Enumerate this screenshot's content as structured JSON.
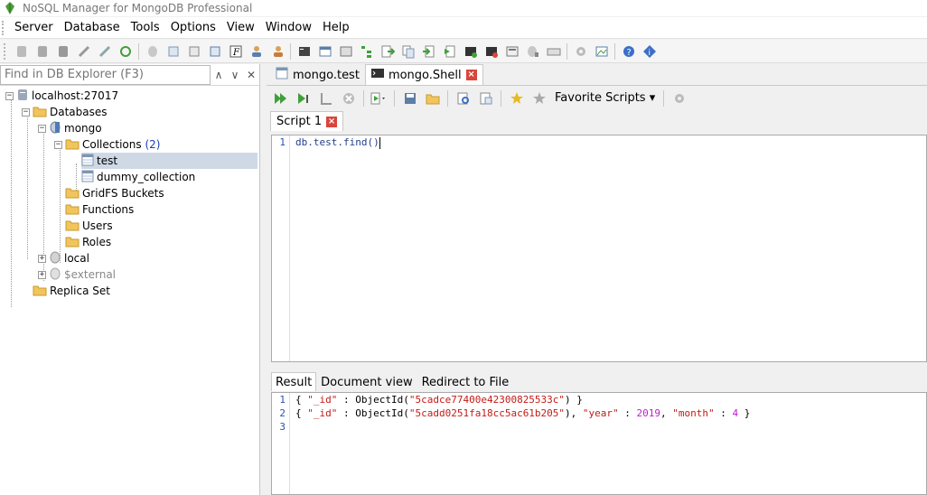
{
  "window": {
    "title": "NoSQL Manager for MongoDB Professional"
  },
  "menu": [
    "Server",
    "Database",
    "Tools",
    "Options",
    "View",
    "Window",
    "Help"
  ],
  "explorer": {
    "search_placeholder": "Find in DB Explorer (F3)",
    "nodes": {
      "server": "localhost:27017",
      "databases": "Databases",
      "mongo": "mongo",
      "collections": "Collections",
      "collections_count": "(2)",
      "test": "test",
      "dummy": "dummy_collection",
      "gridfs": "GridFS Buckets",
      "functions": "Functions",
      "users": "Users",
      "roles": "Roles",
      "local": "local",
      "external": "$external",
      "replica": "Replica Set"
    }
  },
  "doc_tabs": [
    {
      "label": "mongo.test"
    },
    {
      "label": "mongo.Shell"
    }
  ],
  "shell_toolbar": {
    "favorite_scripts": "Favorite Scripts"
  },
  "script_tab": {
    "label": "Script 1"
  },
  "editor": {
    "line_numbers": [
      "1"
    ],
    "code": "db.test.find()"
  },
  "result_tabs": [
    "Result",
    "Document view",
    "Redirect to File"
  ],
  "results": {
    "line_numbers": [
      "1",
      "2",
      "3"
    ],
    "row1": {
      "open": "{ ",
      "id_key": "\"_id\"",
      "sep": " : ObjectId(",
      "id_val": "\"5cadce77400e42300825533c\"",
      "close": ") }"
    },
    "row2": {
      "open": "{ ",
      "id_key": "\"_id\"",
      "sep": " : ObjectId(",
      "id_val": "\"5cadd0251fa18cc5ac61b205\"",
      "mid": "), ",
      "year_key": "\"year\"",
      "colon1": " : ",
      "year_val": "2019",
      "comma": ", ",
      "month_key": "\"month\"",
      "colon2": " : ",
      "month_val": "4",
      "close": " }"
    }
  },
  "colors": {
    "selection": "#cfd9e6",
    "count": "#1a3db8",
    "string": "#c41a16",
    "number": "#c41ad0",
    "close_tab": "#d9453b"
  }
}
